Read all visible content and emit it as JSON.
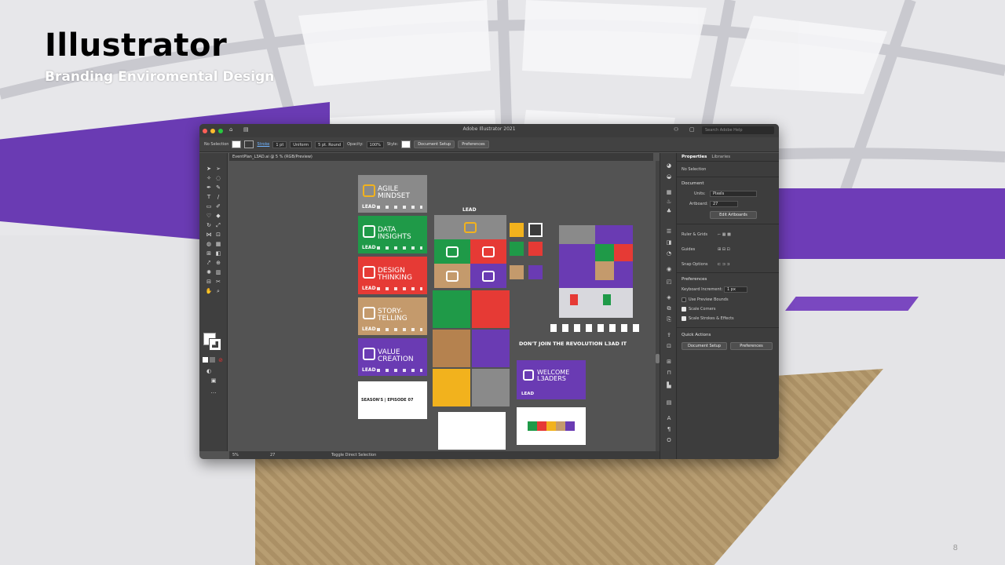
{
  "slide": {
    "title": "Illustrator",
    "subtitle": "Branding Enviromental Design",
    "page_number": "8"
  },
  "window": {
    "title": "Adobe Illustrator 2021",
    "search_placeholder": "Search Adobe Help"
  },
  "control_bar": {
    "selection": "No Selection",
    "stroke_label": "Stroke",
    "stroke_value": "1 pt",
    "profile": "Uniform",
    "brush": "5 pt. Round",
    "opacity_label": "Opacity:",
    "opacity_value": "100%",
    "style_label": "Style:",
    "document_setup": "Document Setup",
    "preferences": "Preferences"
  },
  "document_tab": "EventPlan_L3AD.ai @ 5 % (RGB/Preview)",
  "artboards": {
    "cards": [
      {
        "text": "AGILE\nMINDSET",
        "lead": "LEAD",
        "color": "#8a8a8a",
        "accent": "#f2b21d"
      },
      {
        "text": "DATA\nINSIGHTS",
        "lead": "LEAD",
        "color": "#1f9a48",
        "accent": "#ffffff"
      },
      {
        "text": "DESIGN\nTHINKING",
        "lead": "LEAD",
        "color": "#e63a35",
        "accent": "#ffffff"
      },
      {
        "text": "STORY-\nTELLING",
        "lead": "LEAD",
        "color": "#c49a6c",
        "accent": "#ffffff"
      },
      {
        "text": "VALUE\nCREATION",
        "lead": "LEAD",
        "color": "#6a3bb3",
        "accent": "#ffffff"
      }
    ],
    "season_text": "SEASON'S | EPISODE 07",
    "lead_label": "LEAD",
    "welcome_text": "WELCOME\nL3ADERS",
    "welcome_lead": "LEAD",
    "revolution": "DON'T JOIN THE REVOLUTION L3AD IT",
    "tile_colors": [
      "#8a8a8a",
      "#1f9a48",
      "#e63a35",
      "#c49a6c",
      "#6a3bb3"
    ],
    "pattern_colors": [
      "#1f9a48",
      "#e63a35",
      "#b5824f",
      "#6a3bb3",
      "#f2b21d",
      "#8a8a8a"
    ]
  },
  "status_bar": {
    "zoom": "5%",
    "artboard": "27",
    "tool": "Toggle Direct Selection"
  },
  "properties": {
    "tabs": [
      "Properties",
      "Libraries"
    ],
    "selection": "No Selection",
    "document_head": "Document",
    "units_label": "Units:",
    "units_value": "Pixels",
    "artboard_label": "Artboard:",
    "artboard_value": "27",
    "edit_artboards": "Edit Artboards",
    "ruler_grids": "Ruler & Grids",
    "guides": "Guides",
    "snap_options": "Snap Options",
    "preferences_head": "Preferences",
    "keyboard_increment_label": "Keyboard Increment:",
    "keyboard_increment_value": "1 px",
    "use_preview_bounds": "Use Preview Bounds",
    "scale_corners": "Scale Corners",
    "scale_strokes": "Scale Strokes & Effects",
    "quick_actions": "Quick Actions",
    "document_setup": "Document Setup",
    "preferences": "Preferences"
  },
  "colors": {
    "traffic_red": "#ff5f57",
    "traffic_yellow": "#febc2e",
    "traffic_green": "#28c840",
    "room_purple": "#6a3bb3"
  }
}
